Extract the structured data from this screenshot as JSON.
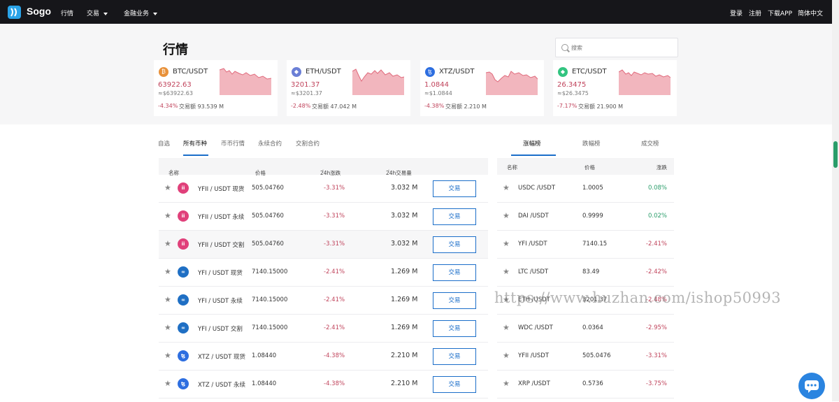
{
  "app": {
    "name": "Sogo"
  },
  "nav": {
    "items": [
      "行情",
      "交易",
      "金融业务"
    ],
    "right": [
      "登录",
      "注册",
      "下载APP",
      "简体中文"
    ]
  },
  "page": {
    "title": "行情"
  },
  "search": {
    "placeholder": "搜索"
  },
  "cards": [
    {
      "pair": "BTC/USDT",
      "price": "63922.63",
      "equiv": "≈$63922.63",
      "change": "-4.34%",
      "volume_label": "交易额 93.539 M",
      "icon_color": "#e8913a"
    },
    {
      "pair": "ETH/USDT",
      "price": "3201.37",
      "equiv": "≈$3201.37",
      "change": "-2.48%",
      "volume_label": "交易额 47.042 M",
      "icon_color": "#6b7fd6"
    },
    {
      "pair": "XTZ/USDT",
      "price": "1.0844",
      "equiv": "≈$1.0844",
      "change": "-4.38%",
      "volume_label": "交易额 2.210 M",
      "icon_color": "#2d6ee0"
    },
    {
      "pair": "ETC/USDT",
      "price": "26.3475",
      "equiv": "≈$26.3475",
      "change": "-7.17%",
      "volume_label": "交易额 21.900 M",
      "icon_color": "#32c480"
    }
  ],
  "tabs": [
    "自选",
    "所有币种",
    "币币行情",
    "永续合约",
    "交割合约"
  ],
  "active_tab": "所有币种",
  "table": {
    "headers": {
      "name": "名称",
      "price": "价格",
      "change": "24h涨跌",
      "volume": "24h交易量"
    },
    "trade_label": "交易",
    "rows": [
      {
        "pair": "YFII / USDT 现货",
        "price": "505.04760",
        "change": "-3.31%",
        "volume": "3.032 M",
        "icon_color": "#e0407a"
      },
      {
        "pair": "YFII / USDT 永续",
        "price": "505.04760",
        "change": "-3.31%",
        "volume": "3.032 M",
        "icon_color": "#e0407a"
      },
      {
        "pair": "YFII / USDT 交割",
        "price": "505.04760",
        "change": "-3.31%",
        "volume": "3.032 M",
        "icon_color": "#e0407a"
      },
      {
        "pair": "YFI / USDT 现货",
        "price": "7140.15000",
        "change": "-2.41%",
        "volume": "1.269 M",
        "icon_color": "#1f6fc4"
      },
      {
        "pair": "YFI / USDT 永续",
        "price": "7140.15000",
        "change": "-2.41%",
        "volume": "1.269 M",
        "icon_color": "#1f6fc4"
      },
      {
        "pair": "YFI / USDT 交割",
        "price": "7140.15000",
        "change": "-2.41%",
        "volume": "1.269 M",
        "icon_color": "#1f6fc4"
      },
      {
        "pair": "XTZ / USDT 现货",
        "price": "1.08440",
        "change": "-4.38%",
        "volume": "2.210 M",
        "icon_color": "#2d6ee0"
      },
      {
        "pair": "XTZ / USDT 永续",
        "price": "1.08440",
        "change": "-4.38%",
        "volume": "2.210 M",
        "icon_color": "#2d6ee0"
      }
    ]
  },
  "rank": {
    "tabs": [
      "涨幅榜",
      "跌幅榜",
      "成交榜"
    ],
    "active_tab": "涨幅榜",
    "headers": {
      "name": "名称",
      "price": "价格",
      "change": "涨跌"
    },
    "rows": [
      {
        "pair": "USDC /USDT",
        "price": "1.0005",
        "change": "0.08%",
        "dir": "up"
      },
      {
        "pair": "DAI /USDT",
        "price": "0.9999",
        "change": "0.02%",
        "dir": "up"
      },
      {
        "pair": "YFI /USDT",
        "price": "7140.15",
        "change": "-2.41%",
        "dir": "down"
      },
      {
        "pair": "LTC /USDT",
        "price": "83.49",
        "change": "-2.42%",
        "dir": "down"
      },
      {
        "pair": "ETH /USDT",
        "price": "3201.37",
        "change": "-2.48%",
        "dir": "down"
      },
      {
        "pair": "WDC /USDT",
        "price": "0.0364",
        "change": "-2.95%",
        "dir": "down"
      },
      {
        "pair": "YFII /USDT",
        "price": "505.0476",
        "change": "-3.31%",
        "dir": "down"
      },
      {
        "pair": "XRP /USDT",
        "price": "0.5736",
        "change": "-3.75%",
        "dir": "down"
      }
    ]
  },
  "watermark": "https://www.huzhan.com/ishop50993"
}
